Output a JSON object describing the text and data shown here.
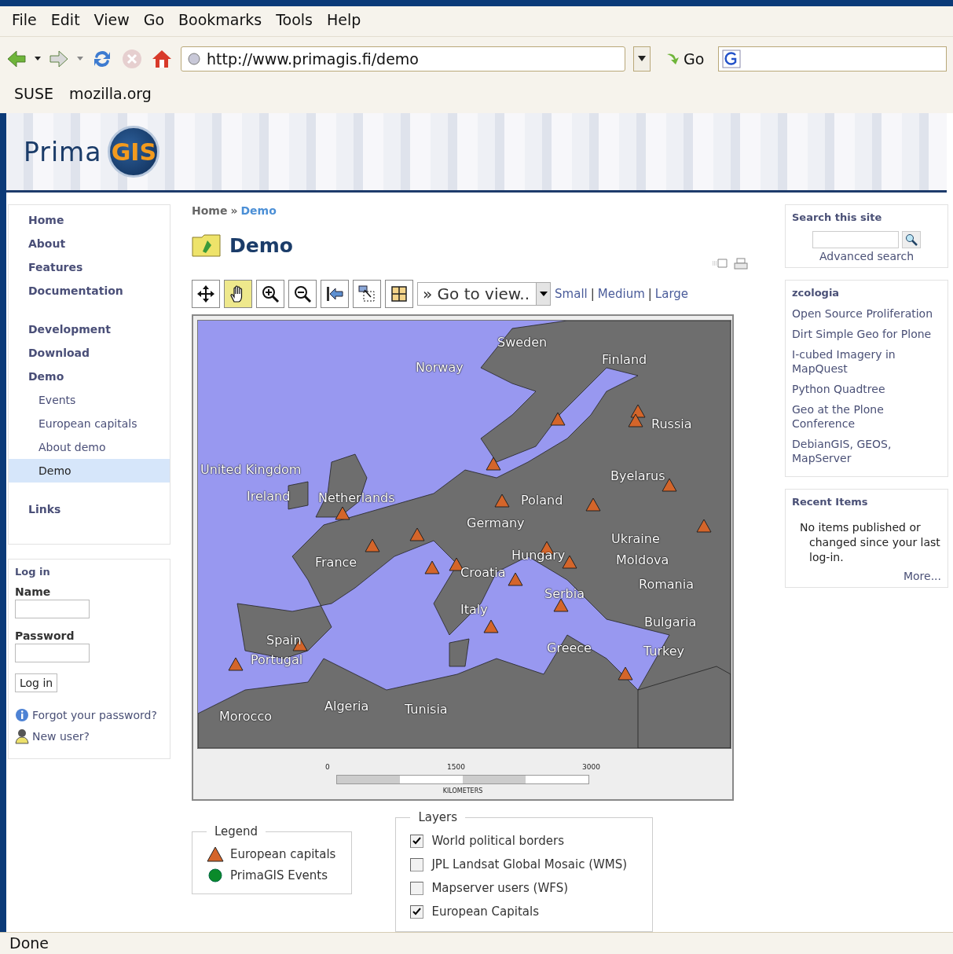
{
  "menu_bar": [
    "File",
    "Edit",
    "View",
    "Go",
    "Bookmarks",
    "Tools",
    "Help"
  ],
  "nav_toolbar": {
    "url": "http://www.primagis.fi/demo",
    "go": "Go"
  },
  "bookmarks": [
    "SUSE",
    "mozilla.org"
  ],
  "site_logo": {
    "name": "Prima",
    "badge": "GIS"
  },
  "nav_portlet": {
    "groups": [
      [
        {
          "label": "Home",
          "selected": false
        },
        {
          "label": "About",
          "selected": false
        },
        {
          "label": "Features",
          "selected": false
        },
        {
          "label": "Documentation",
          "selected": false
        }
      ],
      [
        {
          "label": "Development",
          "selected": false
        },
        {
          "label": "Download",
          "selected": false
        },
        {
          "label": "Demo",
          "selected": false,
          "children": [
            {
              "label": "Events",
              "selected": false
            },
            {
              "label": "European capitals",
              "selected": false
            },
            {
              "label": "About demo",
              "selected": false
            },
            {
              "label": "Demo",
              "selected": true
            }
          ]
        }
      ],
      [
        {
          "label": "Links",
          "selected": false
        }
      ]
    ]
  },
  "login_portlet": {
    "title": "Log in",
    "name_label": "Name",
    "password_label": "Password",
    "button": "Log in",
    "forgot": "Forgot your password?",
    "new_user": "New user?"
  },
  "breadcrumb": {
    "items": [
      "Home",
      "Demo"
    ],
    "separator": "»"
  },
  "page_title": "Demo",
  "map_toolbar": {
    "tools": [
      {
        "kind": "pan-arrows",
        "selected": false
      },
      {
        "kind": "hand",
        "selected": true
      },
      {
        "kind": "zoom-in",
        "selected": false
      },
      {
        "kind": "zoom-out",
        "selected": false
      },
      {
        "kind": "back",
        "selected": false
      },
      {
        "kind": "zoom-box",
        "selected": false
      },
      {
        "kind": "full-extent",
        "selected": false
      }
    ],
    "view_select": "» Go to view..",
    "sizes": [
      "Small",
      "Medium",
      "Large"
    ],
    "size_separator": "|"
  },
  "map": {
    "labels": [
      "Sweden",
      "Norway",
      "Finland",
      "Russia",
      "United Kingdom",
      "Byelarus",
      "Ireland",
      "Netherlands",
      "Poland",
      "Germany",
      "Ukraine",
      "Hungary",
      "France",
      "Moldova",
      "Croatia",
      "Romania",
      "Serbia",
      "Italy",
      "Bulgaria",
      "Spain",
      "Greece",
      "Turkey",
      "Portugal",
      "Algeria",
      "Tunisia",
      "Morocco"
    ],
    "scale_ticks": [
      "0",
      "1500",
      "3000"
    ],
    "scale_unit": "KILOMETERS"
  },
  "legend": {
    "title": "Legend",
    "items": [
      {
        "kind": "triangle",
        "label": "European capitals"
      },
      {
        "kind": "dot",
        "label": "PrimaGIS Events"
      }
    ]
  },
  "layers": {
    "title": "Layers",
    "items": [
      {
        "label": "World political borders",
        "checked": true
      },
      {
        "label": "JPL Landsat Global Mosaic (WMS)",
        "checked": false
      },
      {
        "label": "Mapserver users (WFS)",
        "checked": false
      },
      {
        "label": "European Capitals",
        "checked": true
      }
    ]
  },
  "search_portlet": {
    "title": "Search this site",
    "link": "Advanced search"
  },
  "news_portlet": {
    "title": "zcologia",
    "links": [
      "Open Source Proliferation",
      "Dirt Simple Geo for Plone",
      "I-cubed Imagery in MapQuest",
      "Python Quadtree",
      "Geo at the Plone Conference",
      "DebianGIS, GEOS, MapServer"
    ]
  },
  "recent_portlet": {
    "title": "Recent Items",
    "text": "No items published or changed since your last log-in.",
    "more": "More..."
  },
  "status_bar": "Done"
}
